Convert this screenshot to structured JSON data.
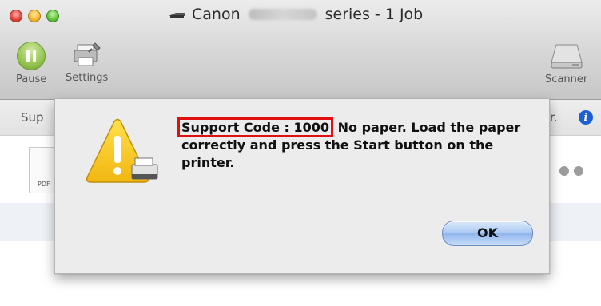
{
  "window": {
    "title_prefix": "Canon",
    "title_suffix": "series - 1 Job"
  },
  "toolbar": {
    "pause_label": "Pause",
    "settings_label": "Settings",
    "scanner_label": "Scanner"
  },
  "infobar": {
    "text_left": "Sup",
    "text_right": "r."
  },
  "job": {
    "doc_type": "PDF"
  },
  "alert": {
    "support_code": "Support Code : 1000",
    "message": "No paper. Load the paper correctly and press the Start button on the printer.",
    "ok_label": "OK"
  },
  "colors": {
    "highlight": "#e01010",
    "info_icon": "#1e5fd6",
    "pause_green": "#8fc14a"
  }
}
